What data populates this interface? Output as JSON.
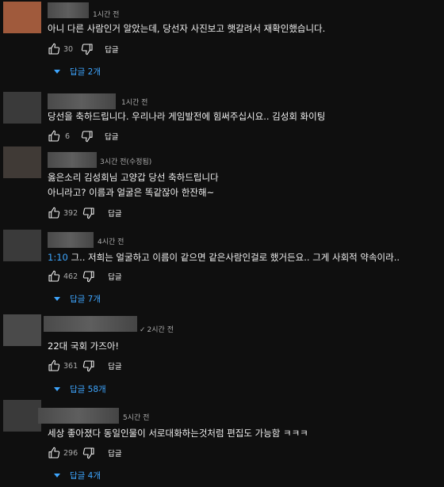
{
  "comments": [
    {
      "time": "1시간 전",
      "lines": [
        "아니 다른 사람인거 알았는데, 당선자  사진보고 햇갈려서 재확인했습니다."
      ],
      "likes": "30",
      "reply_label": "답글",
      "replies": "답글 2개"
    },
    {
      "time": "1시간 전",
      "lines": [
        "당선을 축하드립니다. 우리나라 게임발전에 힘써주십시요.. 김성회 화이팅"
      ],
      "likes": "6",
      "reply_label": "답글",
      "replies": ""
    },
    {
      "time": "3시간 전(수정됨)",
      "lines": [
        "옳은소리 김성회님 고양갑 당선 축하드립니다",
        "아니라고? 이름과 얼굴은 똑같잖아 한잔해~"
      ],
      "likes": "392",
      "reply_label": "답글",
      "replies": ""
    },
    {
      "time": "4시간 전",
      "timestamp": "1:10",
      "lines": [
        " 그.. 저희는 얼굴하고 이름이 같으면 같은사람인걸로 했거든요.. 그게 사회적 약속이라.."
      ],
      "likes": "462",
      "reply_label": "답글",
      "replies": "답글 7개"
    },
    {
      "time": "2시간 전",
      "verified": "✓",
      "lines": [
        "22대 국회 가즈아!"
      ],
      "likes": "361",
      "reply_label": "답글",
      "replies": "답글 58개"
    },
    {
      "time": "5시간 전",
      "lines": [
        "세상 좋아졌다 동일인물이 서로대화하는것처럼 편집도 가능함 ㅋㅋㅋ"
      ],
      "likes": "296",
      "reply_label": "답글",
      "replies": "답글 4개"
    }
  ],
  "icons": {
    "like": "thumb-up-icon",
    "dislike": "thumb-down-icon",
    "expand": "caret-down-icon"
  },
  "colors": {
    "background": "#0f0f0f",
    "link": "#3ea6ff",
    "text": "#f1f1f1",
    "meta": "#aaaaaa"
  }
}
